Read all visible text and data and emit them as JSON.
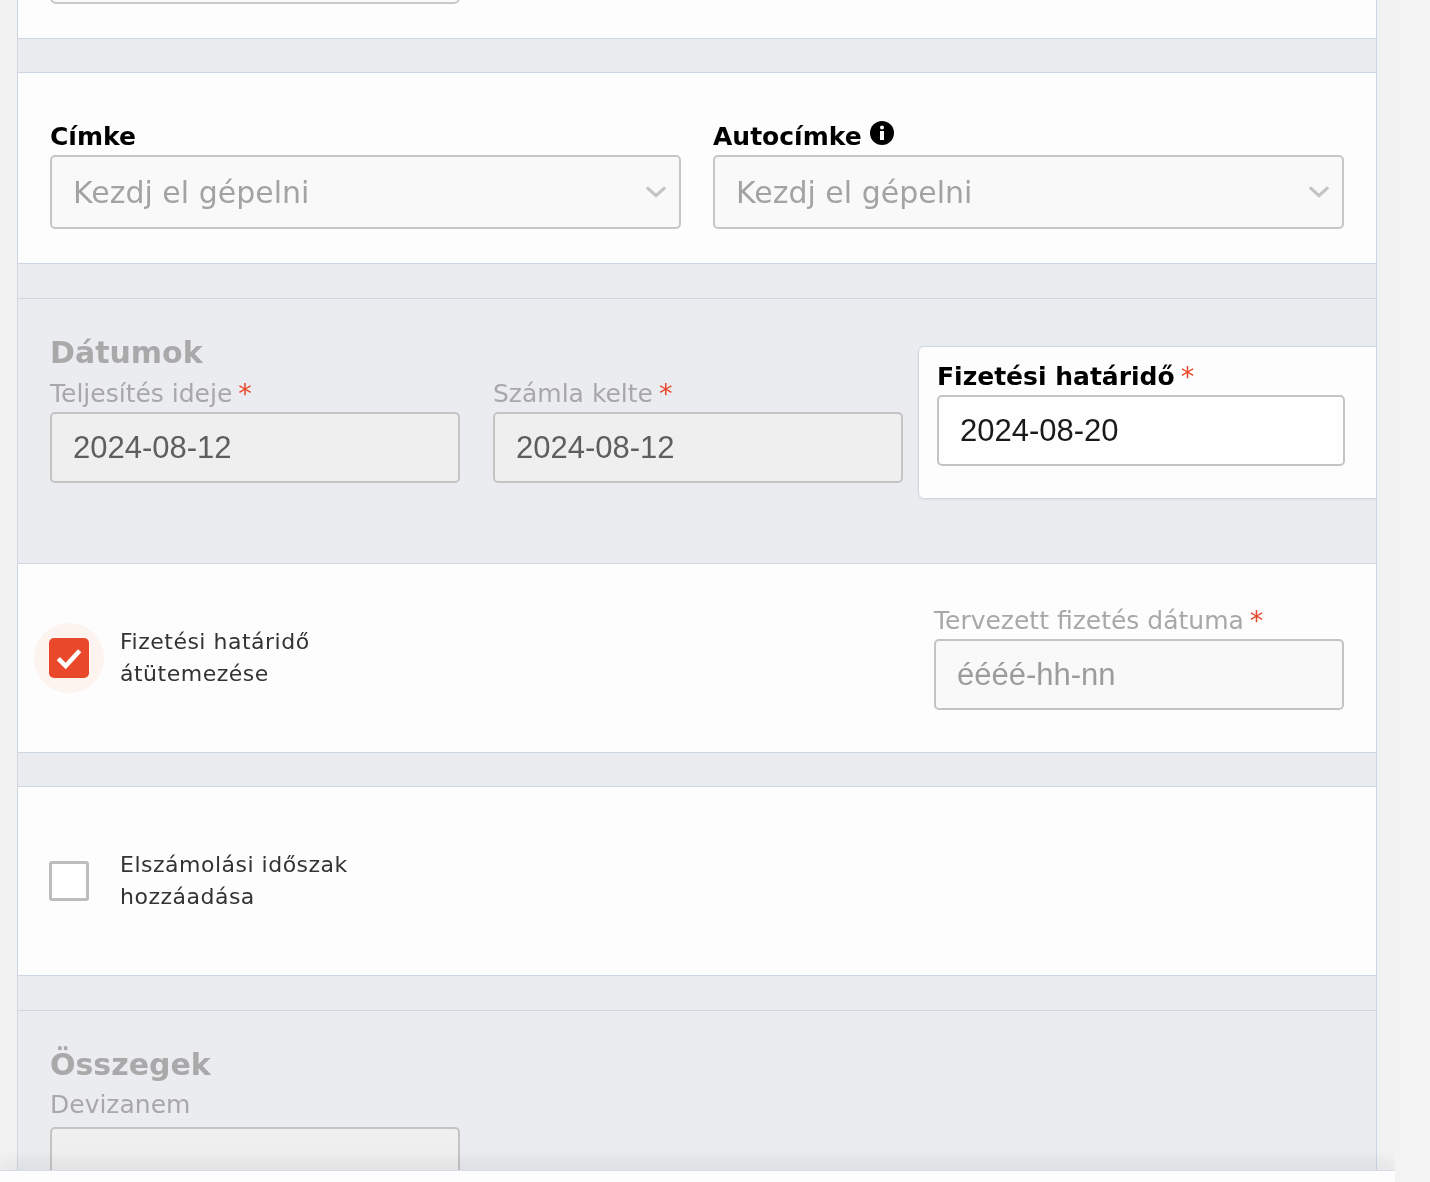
{
  "tags": {
    "fields": [
      {
        "label": "Címke",
        "placeholder": "Kezdj el gépelni",
        "info": false
      },
      {
        "label": "Autocímke",
        "placeholder": "Kezdj el gépelni",
        "info": true
      }
    ]
  },
  "dates": {
    "title": "Dátumok",
    "fields": [
      {
        "label": "Teljesítés ideje",
        "required_mark": "*",
        "value": "2024-08-12",
        "disabled": true
      },
      {
        "label": "Számla kelte",
        "required_mark": "*",
        "value": "2024-08-12",
        "disabled": true
      },
      {
        "label": "Fizetési határidő",
        "required_mark": "*",
        "value": "2024-08-20",
        "disabled": false
      }
    ]
  },
  "reschedule": {
    "checkbox": {
      "label": "Fizetési határidő átütemezése",
      "checked": true
    },
    "field": {
      "label": "Tervezett fizetés dátuma",
      "required_mark": "*",
      "placeholder": "éééé-hh-nn"
    }
  },
  "billing_period": {
    "checkbox": {
      "label": "Elszámolási időszak hozzáadása",
      "checked": false
    }
  },
  "amounts": {
    "title": "Összegek",
    "fields": [
      {
        "label": "Devizanem"
      }
    ]
  }
}
